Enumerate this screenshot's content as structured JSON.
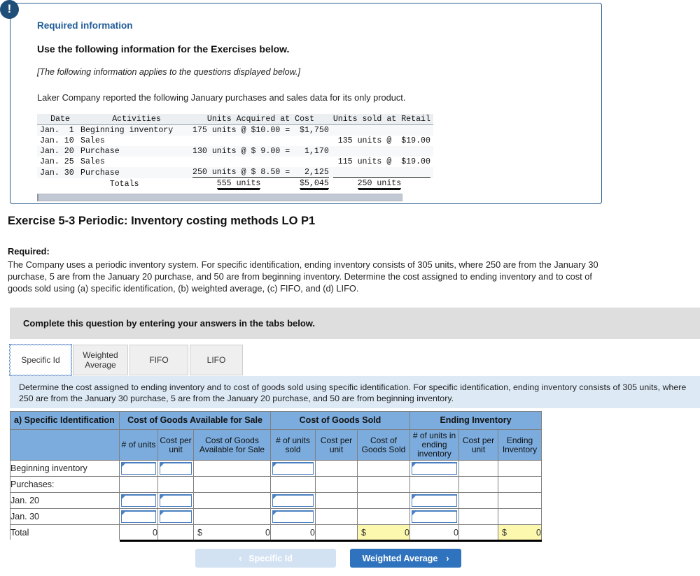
{
  "alert": {
    "icon": "exclamation-icon",
    "glyph": "!"
  },
  "required_panel": {
    "heading": "Required information",
    "subheading": "Use the following information for the Exercises below.",
    "italic_note": "[The following information applies to the questions displayed below.]",
    "intro": "Laker Company reported the following January purchases and sales data for its only product.",
    "table": {
      "headers": [
        "Date",
        "Activities",
        "Units Acquired at Cost",
        "Units sold at Retail"
      ],
      "rows": [
        {
          "date": "Jan.  1",
          "activity": "Beginning inventory",
          "acquired": "175 units @ $10.00 =  $1,750",
          "sold": ""
        },
        {
          "date": "Jan. 10",
          "activity": "Sales",
          "acquired": "",
          "sold": "135 units @  $19.00"
        },
        {
          "date": "Jan. 20",
          "activity": "Purchase",
          "acquired": "130 units @ $ 9.00 =   1,170",
          "sold": ""
        },
        {
          "date": "Jan. 25",
          "activity": "Sales",
          "acquired": "",
          "sold": "115 units @  $19.00"
        },
        {
          "date": "Jan. 30",
          "activity": "Purchase",
          "acquired": "250 units @ $ 8.50 =   2,125",
          "sold": ""
        }
      ],
      "totals": {
        "label": "Totals",
        "units": "555 units",
        "cost": "$5,045",
        "sold": "250 units"
      }
    }
  },
  "exercise": {
    "title": "Exercise 5-3 Periodic: Inventory costing methods LO P1",
    "required_label": "Required:",
    "required_body": "The Company uses a periodic inventory system. For specific identification, ending inventory consists of 305 units, where 250 are from the January 30 purchase, 5 are from the January 20 purchase, and 50 are from beginning inventory. Determine the cost assigned to ending inventory and to cost of goods sold using (a) specific identification, (b) weighted average, (c) FIFO, and (d) LIFO."
  },
  "complete_bar": {
    "text": "Complete this question by entering your answers in the tabs below."
  },
  "tabs": [
    {
      "label": "Specific Id",
      "active": true
    },
    {
      "label": "Weighted Average",
      "active": false
    },
    {
      "label": "FIFO",
      "active": false
    },
    {
      "label": "LIFO",
      "active": false
    }
  ],
  "blue_instruction": {
    "text": "Determine the cost assigned to ending inventory and to cost of goods sold using specific identification. For specific identification, ending inventory consists of 305 units, where 250 are from the January 30 purchase, 5 are from the January 20 purchase, and 50 are from beginning inventory."
  },
  "answer_table": {
    "corner_label": "a) Specific Identification",
    "group_headers": [
      "Cost of Goods Available for Sale",
      "Cost of Goods Sold",
      "Ending Inventory"
    ],
    "sub_headers": [
      "# of units",
      "Cost per unit",
      "Cost of Goods Available for Sale",
      "# of units sold",
      "Cost per unit",
      "Cost of Goods Sold",
      "# of units in ending inventory",
      "Cost per unit",
      "Ending Inventory"
    ],
    "rows": [
      {
        "label": "Beginning inventory",
        "indent": false
      },
      {
        "label": "Purchases:",
        "indent": false
      },
      {
        "label": "Jan. 20",
        "indent": true
      },
      {
        "label": "Jan. 30",
        "indent": true
      }
    ],
    "total_row": {
      "label": "Total",
      "units": "0",
      "cost_per_unit": "",
      "goods_available_dollar": "$",
      "goods_available": "0",
      "units_sold": "0",
      "cogs_cost_per_unit": "",
      "cogs_dollar": "$",
      "cogs": "0",
      "ending_units": "0",
      "ending_cost_per_unit": "",
      "ending_dollar": "$",
      "ending_inventory": "0"
    }
  },
  "nav": {
    "prev_label": "Specific Id",
    "prev_chevron": "‹",
    "next_label": "Weighted Average",
    "next_chevron": "›"
  }
}
